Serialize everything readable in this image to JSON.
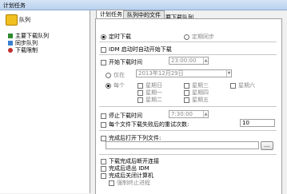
{
  "window": {
    "title": "计划任务"
  },
  "sidebar": {
    "header": "队列",
    "items": [
      {
        "label": "主要下载队列",
        "icon_color": "#2e8b2e"
      },
      {
        "label": "同步队列",
        "icon_color": "#3a7fd0"
      },
      {
        "label": "下载限制",
        "icon_color": "#c03030"
      }
    ]
  },
  "header": {
    "title": "主要下载队列"
  },
  "tabs": [
    {
      "label": "计划任务",
      "active": true
    },
    {
      "label": "队列中的文件",
      "active": false
    }
  ],
  "schedule": {
    "mode_one_time": "定时下载",
    "mode_sync": "定期同步",
    "idm_autostart": "IDM 启动时自动开始下载",
    "start_time_label": "开始下载时间",
    "start_time_value": "23:00:00",
    "on_date_label": "仅在",
    "date_value": "2013年12月29日",
    "every_label": "每个",
    "weekdays": [
      "星期日",
      "星期三",
      "星期六",
      "星期一",
      "星期四",
      "星期二",
      "星期五"
    ],
    "stop_time_label": "停止下载时间",
    "stop_time_value": "7:30:00",
    "retry_label": "每个文件下载失败后的重试次数:",
    "retry_value": "10",
    "open_file_label": "完成后打开下列文件:",
    "open_file_value": "",
    "browse_button": "...",
    "disconnect_label": "下载完成后断开连接",
    "exit_idm_label": "完成后退出 IDM",
    "shutdown_label": "完成后关闭计算机",
    "force_terminate_label": "强制终止进程"
  }
}
